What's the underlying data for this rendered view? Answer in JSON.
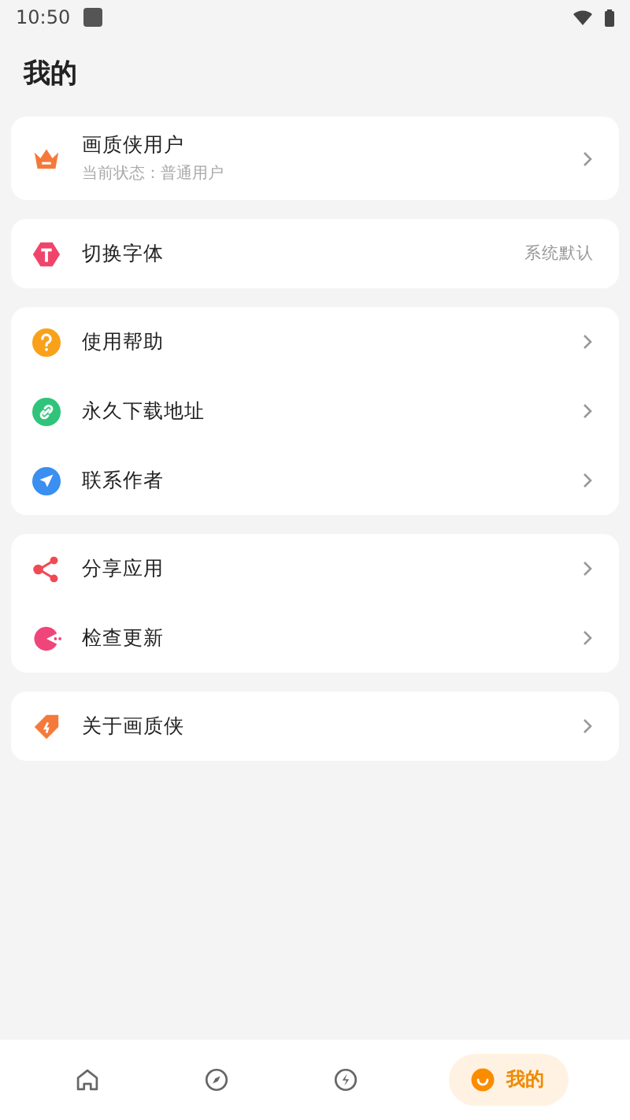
{
  "status_bar": {
    "time": "10:50"
  },
  "title": "我的",
  "groups": [
    {
      "items": [
        {
          "kind": "crown",
          "label": "画质侠用户",
          "subtitle": "当前状态：普通用户"
        }
      ]
    },
    {
      "items": [
        {
          "kind": "font",
          "label": "切换字体",
          "value": "系统默认"
        }
      ]
    },
    {
      "items": [
        {
          "kind": "help",
          "label": "使用帮助"
        },
        {
          "kind": "link",
          "label": "永久下载地址"
        },
        {
          "kind": "send",
          "label": "联系作者"
        }
      ]
    },
    {
      "items": [
        {
          "kind": "share",
          "label": "分享应用"
        },
        {
          "kind": "pacman",
          "label": "检查更新"
        }
      ]
    },
    {
      "items": [
        {
          "kind": "tag",
          "label": "关于画质侠"
        }
      ]
    }
  ],
  "nav": [
    {
      "kind": "home",
      "selected": false
    },
    {
      "kind": "compass",
      "selected": false
    },
    {
      "kind": "bolt",
      "selected": false
    },
    {
      "kind": "smile",
      "selected": true,
      "label": "我的"
    }
  ]
}
